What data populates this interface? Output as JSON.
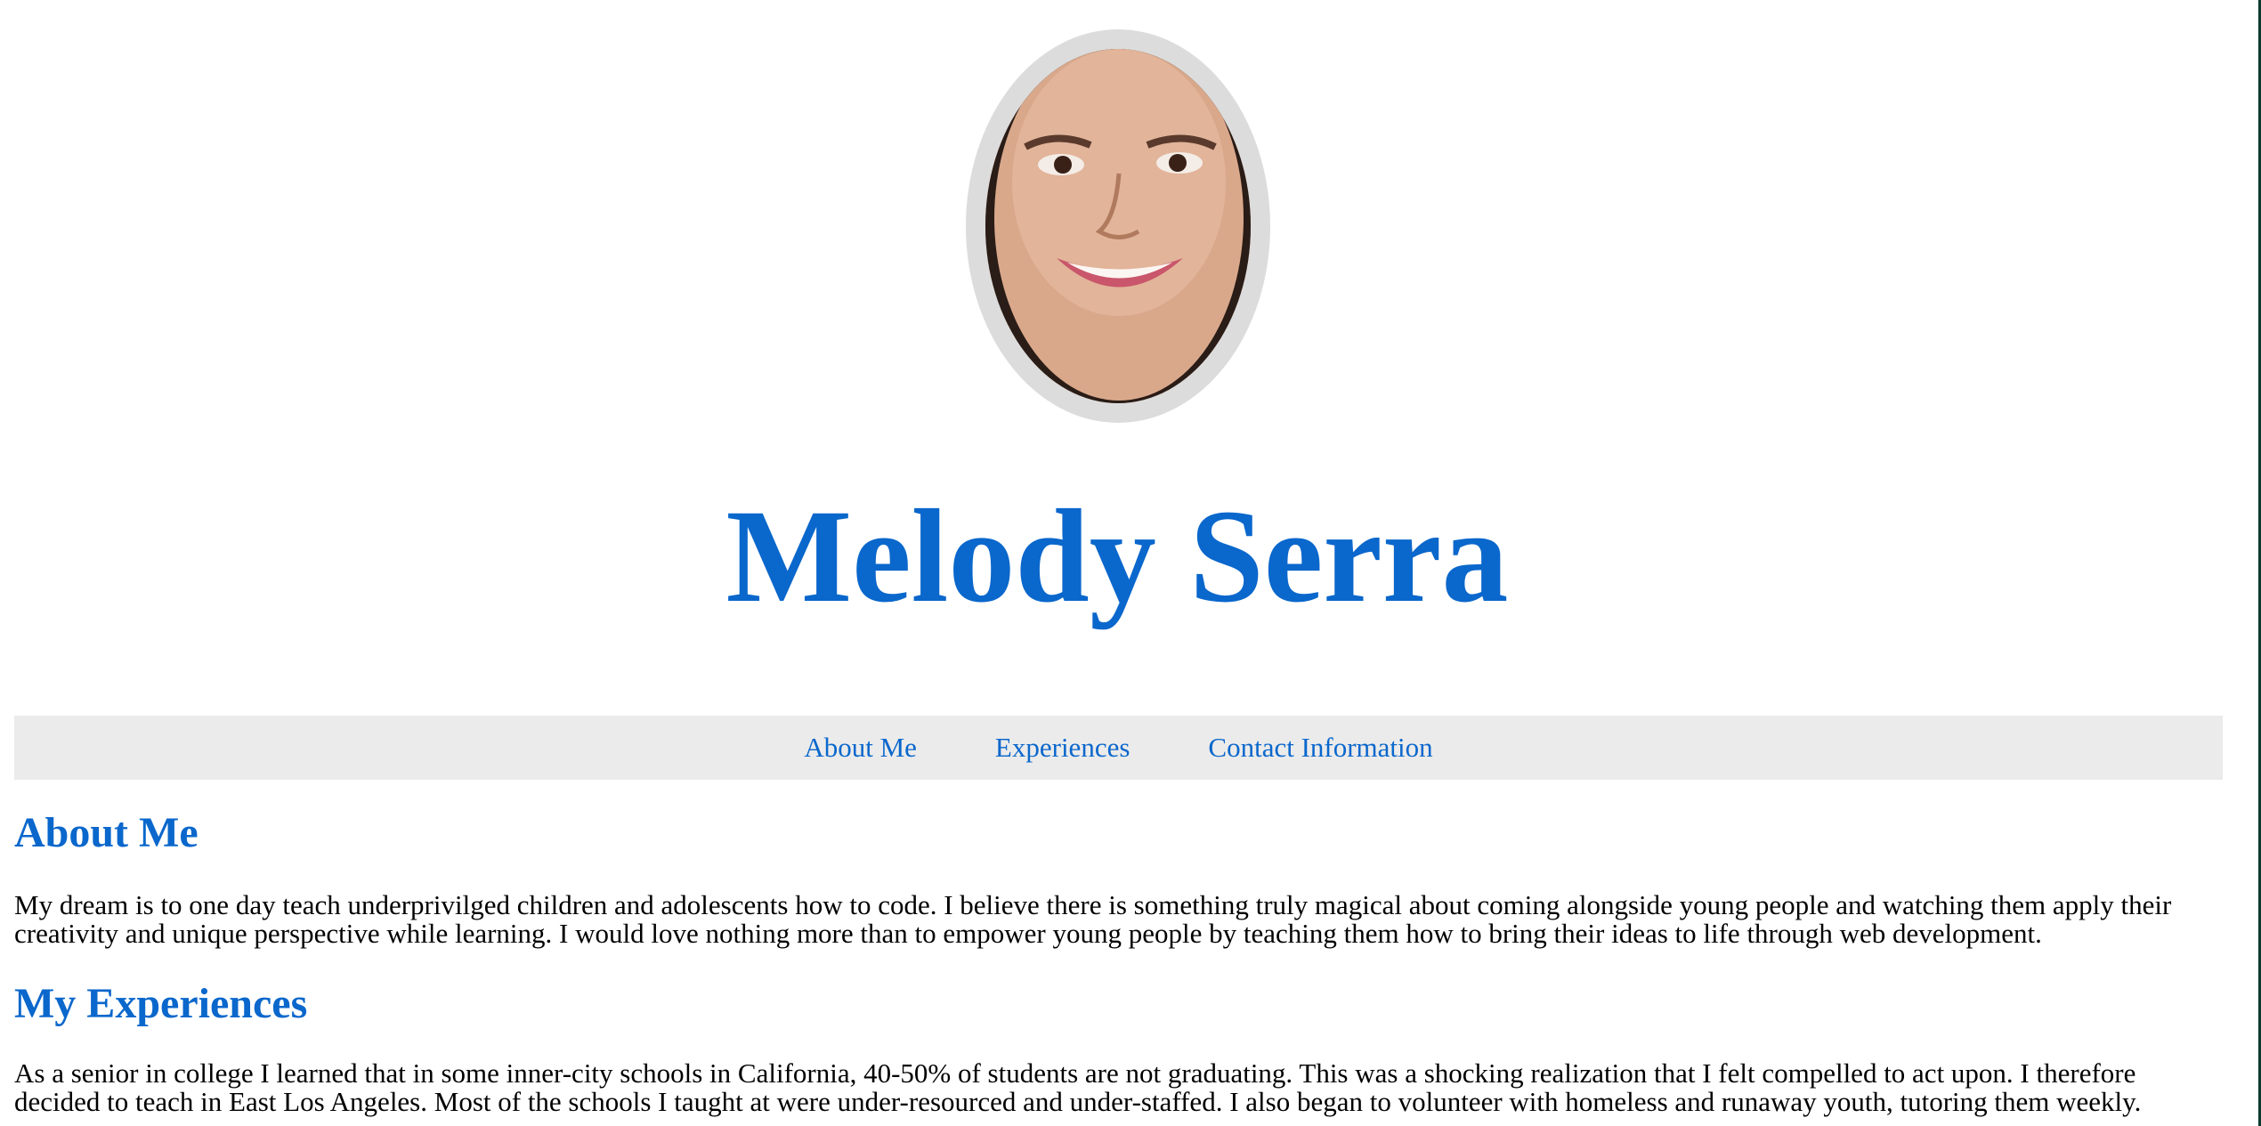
{
  "profile": {
    "name": "Melody Serra",
    "photo_icon": "portrait-photo"
  },
  "nav": {
    "items": [
      {
        "label": "About Me"
      },
      {
        "label": "Experiences"
      },
      {
        "label": "Contact Information"
      }
    ]
  },
  "about": {
    "heading": "About Me",
    "text": "My dream is to one day teach underprivilged children and adolescents how to code. I believe there is something truly magical about coming alongside young people and watching them apply their creativity and unique perspective while learning. I would love nothing more than to empower young people by teaching them how to bring their ideas to life through web development."
  },
  "experiences": {
    "heading": "My Experiences",
    "text": "As a senior in college I learned that in some inner-city schools in California, 40-50% of students are not graduating. This was a shocking realization that I felt compelled to act upon. I therefore decided to teach in East Los Angeles. Most of the schools I taught at were under-resourced and under-staffed. I also began to volunteer with homeless and runaway youth, tutoring them weekly."
  },
  "colors": {
    "accent": "#0a67cc",
    "nav_bg": "#ebebeb",
    "frame": "#dcdcdc"
  }
}
